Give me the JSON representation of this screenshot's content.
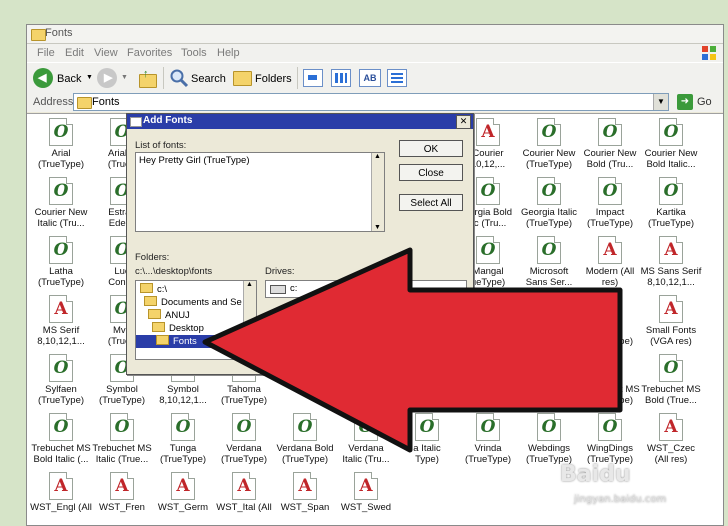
{
  "window": {
    "title": "Fonts"
  },
  "menu": [
    "File",
    "Edit",
    "View",
    "Favorites",
    "Tools",
    "Help"
  ],
  "toolbar": {
    "back": "Back",
    "search": "Search",
    "folders": "Folders"
  },
  "address": {
    "label": "Address",
    "value": "Fonts",
    "go": "Go"
  },
  "icons": [
    {
      "label": "Arial\n(TrueType)",
      "type": "o"
    },
    {
      "label": "Arial B\n(TrueT",
      "type": "o"
    },
    {
      "label": "Courier\n10,12,...",
      "type": "a"
    },
    {
      "label": "Courier New\n(TrueType)",
      "type": "o"
    },
    {
      "label": "Courier New\nBold (Tru...",
      "type": "o"
    },
    {
      "label": "Courier New\nBold Italic...",
      "type": "o"
    },
    {
      "label": "Courier New\nItalic (Tru...",
      "type": "o"
    },
    {
      "label": "Estran\nEdess",
      "type": "o"
    },
    {
      "label": "eorgia Bold\nlic (Tru...",
      "type": "o"
    },
    {
      "label": "Georgia Italic\n(TrueType)",
      "type": "o"
    },
    {
      "label": "Impact\n(TrueType)",
      "type": "o"
    },
    {
      "label": "Kartika\n(TrueType)",
      "type": "o"
    },
    {
      "label": "Latha\n(TrueType)",
      "type": "o"
    },
    {
      "label": "Luc\nConso",
      "type": "o"
    },
    {
      "label": "Mangal\nueType)",
      "type": "o"
    },
    {
      "label": "Microsoft\nSans Ser...",
      "type": "o"
    },
    {
      "label": "Modern (All\nres)",
      "type": "a"
    },
    {
      "label": "MS Sans Serif\n8,10,12,1...",
      "type": "a"
    },
    {
      "label": "MS Serif\n8,10,12,1...",
      "type": "a"
    },
    {
      "label": "Mv I\n(TrueT",
      "type": "o"
    },
    {
      "label": "oman (All",
      "type": "a"
    },
    {
      "label": "Script (All\nres)",
      "type": "a"
    },
    {
      "label": "Shruti\n(TrueType)",
      "type": "o"
    },
    {
      "label": "Small Fonts\n(VGA res)",
      "type": "a"
    },
    {
      "label": "Sylfaen\n(TrueType)",
      "type": "o"
    },
    {
      "label": "Symbol\n(TrueType)",
      "type": "o"
    },
    {
      "label": "Symbol\n8,10,12,1...",
      "type": "a"
    },
    {
      "label": "Tahoma\n(TrueType)",
      "type": "o"
    },
    {
      "label": "Roman B...",
      "type": "o"
    },
    {
      "label": "mes New\nRoman It...",
      "type": "o"
    },
    {
      "label": "Trebuchet MS\n(TrueType)",
      "type": "o"
    },
    {
      "label": "Trebuchet MS\nBold (True...",
      "type": "o"
    },
    {
      "label": "Trebuchet MS\nBold Italic (...",
      "type": "o"
    },
    {
      "label": "Trebuchet MS\nItalic (True...",
      "type": "o"
    },
    {
      "label": "Tunga\n(TrueType)",
      "type": "o"
    },
    {
      "label": "Verdana\n(TrueType)",
      "type": "o"
    },
    {
      "label": "Verdana Bold\n(TrueType)",
      "type": "o"
    },
    {
      "label": "Verdana\nItalic (Tru...",
      "type": "o"
    },
    {
      "label": "a Italic\nType)",
      "type": "o"
    },
    {
      "label": "Vrinda\n(TrueType)",
      "type": "o"
    },
    {
      "label": "Webdings\n(TrueType)",
      "type": "o"
    },
    {
      "label": "WingDings\n(TrueType)",
      "type": "o"
    },
    {
      "label": "WST_Czec\n(All res)",
      "type": "a"
    },
    {
      "label": "WST_Engl (All",
      "type": "a"
    },
    {
      "label": "WST_Fren",
      "type": "a"
    },
    {
      "label": "WST_Germ",
      "type": "a"
    },
    {
      "label": "WST_Ital (All",
      "type": "a"
    },
    {
      "label": "WST_Span",
      "type": "a"
    },
    {
      "label": "WST_Swed",
      "type": "a"
    }
  ],
  "dialog": {
    "title": "Add Fonts",
    "list_label": "List of fonts:",
    "list_item": "Hey Pretty Girl (TrueType)",
    "ok": "OK",
    "close": "Close",
    "select_all": "Select All",
    "folders_label": "Folders:",
    "folders_path": "c:\\...\\desktop\\fonts",
    "drives_label": "Drives:",
    "drive_value": "c:",
    "tree": [
      "c:\\",
      "Documents and Se",
      "ANUJ",
      "Desktop",
      "Fonts"
    ]
  },
  "watermark": {
    "brand": "Baidu",
    "site": "jingyan.baidu.com"
  },
  "colors": {
    "arrow": "#e02a33",
    "dialog_title": "#2a3da8",
    "selection": "#2a3da8"
  }
}
